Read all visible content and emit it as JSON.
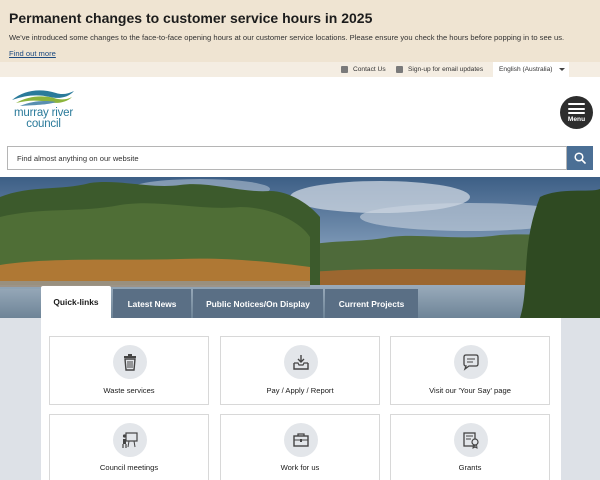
{
  "banner": {
    "title": "Permanent changes to customer service hours in 2025",
    "text": "We've introduced some changes to the face-to-face opening hours at our customer service locations. Please ensure you check the hours before popping in to see us.",
    "link": "Find out more"
  },
  "utility": {
    "contact": "Contact Us",
    "signup": "Sign-up for email updates",
    "language": "English (Australia)"
  },
  "logo": {
    "line1": "murray river",
    "line2": "council"
  },
  "menu": {
    "label": "Menu"
  },
  "search": {
    "placeholder": "Find almost anything on our website"
  },
  "tabs": [
    {
      "label": "Quick-links"
    },
    {
      "label": "Latest News"
    },
    {
      "label": "Public Notices/On Display"
    },
    {
      "label": "Current Projects"
    }
  ],
  "cards": [
    {
      "label": "Waste services",
      "icon": "bin-icon"
    },
    {
      "label": "Pay / Apply / Report",
      "icon": "inbox-icon"
    },
    {
      "label": "Visit our 'Your Say' page",
      "icon": "speech-bubble-icon"
    },
    {
      "label": "Council meetings",
      "icon": "presentation-icon"
    },
    {
      "label": "Work for us",
      "icon": "briefcase-icon"
    },
    {
      "label": "Grants",
      "icon": "certificate-icon"
    }
  ],
  "colors": {
    "banner_bg": "#efe4d2",
    "utility_bg": "#f4ede2",
    "brand_teal": "#2a7a9a",
    "tab_bg": "#5a6f85",
    "search_button": "#4b6f95",
    "link": "#1c4a80"
  }
}
